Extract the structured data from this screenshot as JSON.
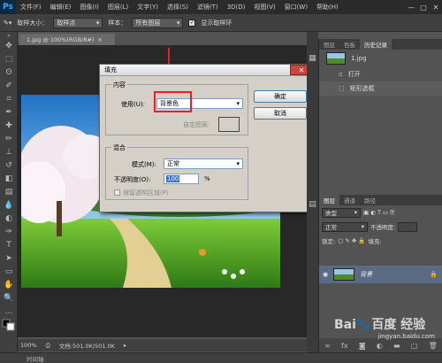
{
  "app": {
    "logo": "Ps"
  },
  "menubar": {
    "items": [
      "文件(F)",
      "编辑(E)",
      "图像(I)",
      "图层(L)",
      "文字(Y)",
      "选择(S)",
      "滤镜(T)",
      "3D(D)",
      "视图(V)",
      "窗口(W)",
      "帮助(H)"
    ],
    "minimize": "—",
    "maximize": "□",
    "close": "✕"
  },
  "options_bar": {
    "sample_size_label": "取样大小：",
    "sample_size_value": "取样点",
    "sample_label": "样本：",
    "sample_value": "所有图层",
    "show_ring_label": "显示取样环",
    "show_ring_checked": "✓"
  },
  "document": {
    "tab_title": "1.jpg @ 100%(RGB/8#)",
    "tab_close": "×",
    "zoom": "100%",
    "doc_info": "文档:501.0K/501.0K"
  },
  "timeline": {
    "label": "时间轴"
  },
  "history_panel": {
    "tabs": [
      "图层",
      "色板",
      "历史记录"
    ],
    "snapshot_name": "1.jpg",
    "items": [
      "打开",
      "矩形选框"
    ]
  },
  "layers_panel": {
    "tabs": [
      "图层",
      "通道",
      "路径"
    ],
    "kind_label": "类型",
    "blend_mode": "正常",
    "opacity_label": "不透明度:",
    "lock_label": "锁定:",
    "fill_label": "填充:",
    "layer_name": "背景"
  },
  "fill_dialog": {
    "title": "填充",
    "close": "✕",
    "contents_group": "内容",
    "use_label": "使用(U):",
    "use_value": "背景色",
    "custom_pattern_label": "自定图案:",
    "ok": "确定",
    "cancel": "取消",
    "blending_group": "混合",
    "mode_label": "模式(M):",
    "mode_value": "正常",
    "opacity_label": "不透明度(O):",
    "opacity_value": "100",
    "opacity_unit": "%",
    "preserve_label": "保留透明区域(P)"
  },
  "watermark": {
    "text": "Bai🐾百度 经验",
    "url": "jingyan.baidu.com"
  },
  "colors": {
    "accent": "#e8202a",
    "selection": "#5b6b84"
  }
}
